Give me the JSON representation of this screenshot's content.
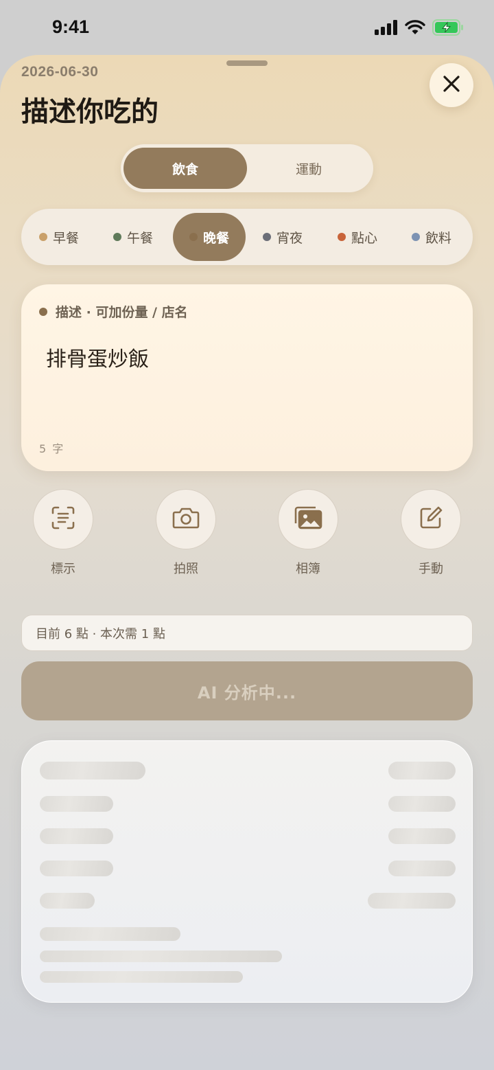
{
  "status_bar": {
    "time": "9:41",
    "icons": [
      "cellular-signal-icon",
      "wifi-icon",
      "battery-charging-icon"
    ],
    "battery_color": "#34c759"
  },
  "sheet": {
    "date": "2026-06-30",
    "title": "描述你吃的",
    "close_icon": "close-icon"
  },
  "mode_tabs": {
    "items": [
      {
        "label": "飲食",
        "active": true
      },
      {
        "label": "運動",
        "active": false
      }
    ]
  },
  "meals": {
    "items": [
      {
        "label": "早餐",
        "color": "#c9a06a",
        "active": false
      },
      {
        "label": "午餐",
        "color": "#5f7a5a",
        "active": false
      },
      {
        "label": "晚餐",
        "color": "#8a6f4d",
        "active": true
      },
      {
        "label": "宵夜",
        "color": "#6b6e78",
        "active": false
      },
      {
        "label": "點心",
        "color": "#c8643a",
        "active": false
      },
      {
        "label": "飲料",
        "color": "#7d93b3",
        "active": false
      }
    ]
  },
  "description": {
    "label": "描述 · 可加份量 / 店名",
    "value": "排骨蛋炒飯",
    "char_count": "5 字"
  },
  "actions": [
    {
      "label": "標示",
      "icon": "scan-text-icon"
    },
    {
      "label": "拍照",
      "icon": "camera-icon"
    },
    {
      "label": "相簿",
      "icon": "photo-album-icon"
    },
    {
      "label": "手動",
      "icon": "edit-icon"
    }
  ],
  "points": {
    "text": "目前 6 點 · 本次需 1 點"
  },
  "analyze": {
    "label": "AI 分析中..."
  },
  "colors": {
    "accent": "#937b5c",
    "analyze_button": "#b3a48f"
  }
}
